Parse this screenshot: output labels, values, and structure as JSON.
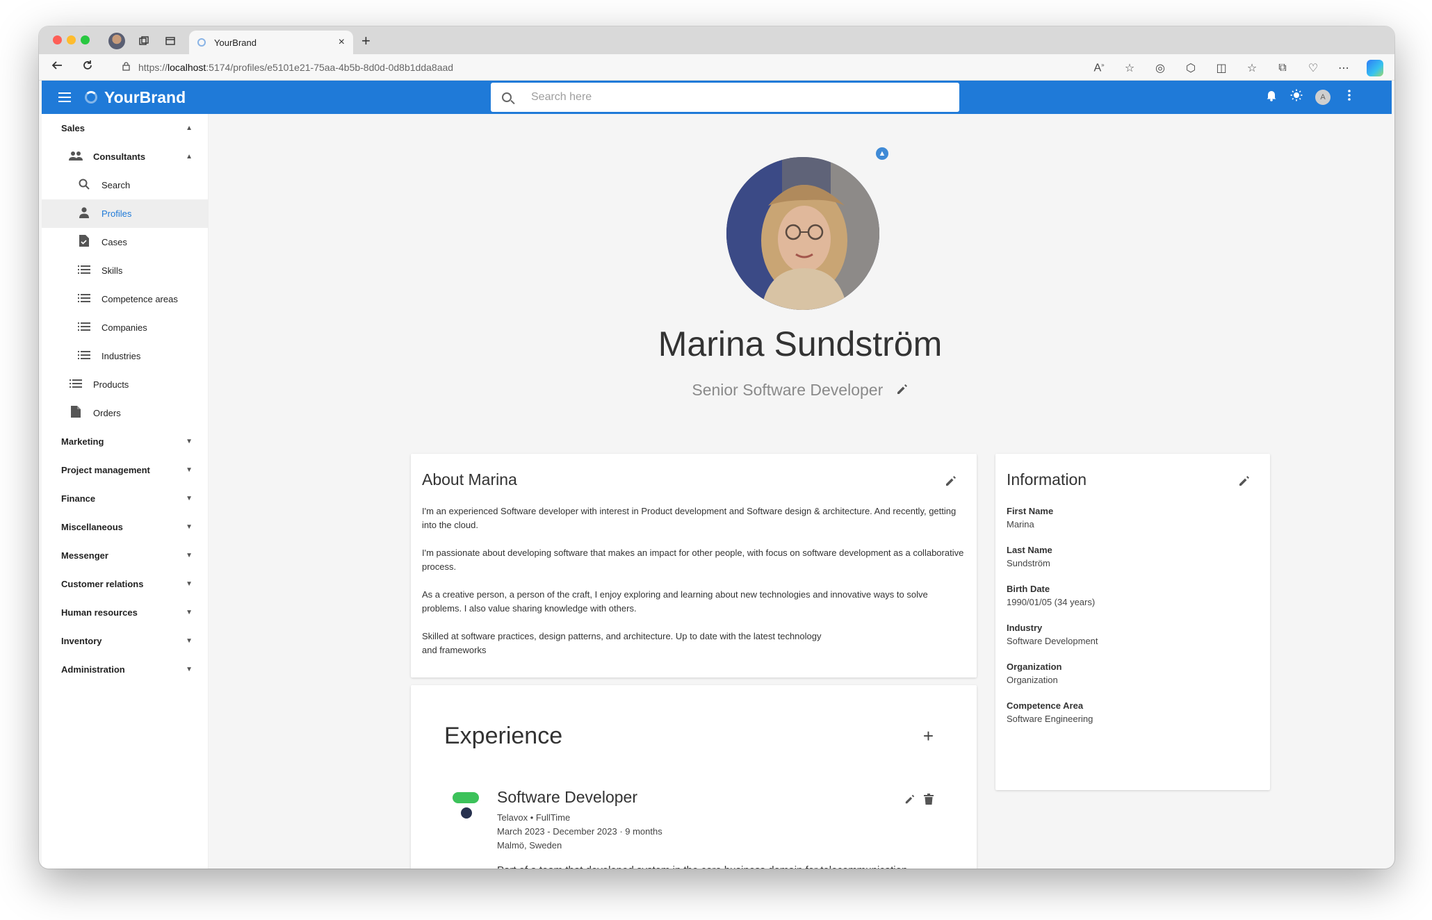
{
  "browser": {
    "tab_title": "YourBrand",
    "tab_close": "×",
    "new_tab": "+",
    "url_prefix": "https://",
    "url_host": "localhost",
    "url_rest": ":5174/profiles/e5101e21-75aa-4b5b-8d0d-0d8b1dda8aad"
  },
  "appbar": {
    "brand": "YourBrand",
    "search_placeholder": "Search here",
    "avatar_initial": "A"
  },
  "sidebar": {
    "sales": "Sales",
    "consultants": "Consultants",
    "consultant_items": [
      "Search",
      "Profiles",
      "Cases",
      "Skills",
      "Competence areas",
      "Companies",
      "Industries"
    ],
    "products": "Products",
    "orders": "Orders",
    "groups": [
      "Marketing",
      "Project management",
      "Finance",
      "Miscellaneous",
      "Messenger",
      "Customer relations",
      "Human resources",
      "Inventory",
      "Administration"
    ]
  },
  "profile": {
    "name": "Marina Sundström",
    "headline": "Senior Software Developer"
  },
  "about": {
    "title": "About Marina",
    "paragraphs": [
      "I'm an experienced Software developer with interest in Product development and Software design & architecture. And recently, getting into the cloud.",
      "I'm passionate about developing software that makes an impact for other people, with focus on software development as a collaborative process.",
      "As a creative person, a person of the craft, I enjoy exploring and learning about new technologies and innovative ways to solve problems. I also value sharing knowledge with others.",
      "Skilled at software practices, design patterns, and architecture. Up to date with the latest technology and frameworks"
    ]
  },
  "information": {
    "title": "Information",
    "fields": [
      {
        "label": "First Name",
        "value": "Marina"
      },
      {
        "label": "Last Name",
        "value": "Sundström"
      },
      {
        "label": "Birth Date",
        "value": "1990/01/05 (34 years)"
      },
      {
        "label": "Industry",
        "value": "Software Development"
      },
      {
        "label": "Organization",
        "value": "Organization"
      },
      {
        "label": "Competence Area",
        "value": "Software Engineering"
      }
    ]
  },
  "experience": {
    "title": "Experience",
    "add": "+",
    "items": [
      {
        "role": "Software Developer",
        "company_line": "Telavox • FullTime",
        "period": "March 2023 - December 2023 · 9 months",
        "location": "Malmö, Sweden",
        "description": "Part of a team that developed system in the core business domain for telecommunication. Among our responsibilities were integrations with other domains."
      }
    ]
  },
  "colors": {
    "appbar": "#1f7ad8",
    "active_link": "#1f7ad8",
    "logo_green": "#3cc25a",
    "logo_navy": "#27314f"
  },
  "icons": {
    "menu": "hamburger-icon",
    "search": "search-icon",
    "bell": "bell-icon",
    "theme": "sun-icon",
    "more": "more-vert-icon",
    "upload": "cloud-upload-icon",
    "edit": "pencil-icon",
    "delete": "trash-icon"
  }
}
